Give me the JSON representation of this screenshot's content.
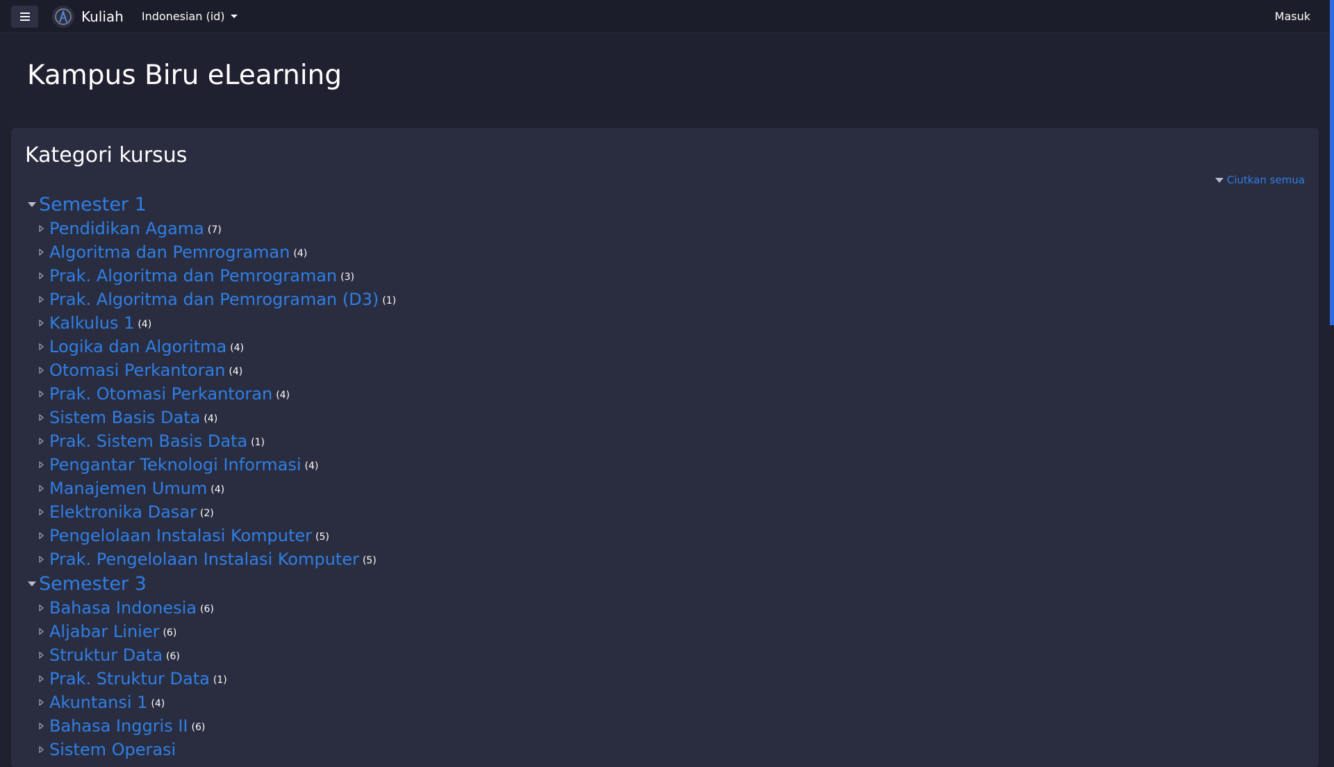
{
  "navbar": {
    "menu_icon": "hamburger-icon",
    "logo_icon": "kuliah-logo-icon",
    "site_name": "Kuliah",
    "language": "Indonesian (id)",
    "login": "Masuk"
  },
  "page": {
    "title": "Kampus Biru eLearning"
  },
  "card": {
    "title": "Kategori kursus",
    "collapse_all": "Ciutkan semua"
  },
  "categories": [
    {
      "name": "Semester 1",
      "items": [
        {
          "name": "Pendidikan Agama",
          "count": "(7)"
        },
        {
          "name": "Algoritma dan Pemrograman",
          "count": "(4)"
        },
        {
          "name": "Prak. Algoritma dan Pemrograman",
          "count": "(3)"
        },
        {
          "name": "Prak. Algoritma dan Pemrograman (D3)",
          "count": "(1)"
        },
        {
          "name": "Kalkulus 1",
          "count": "(4)"
        },
        {
          "name": "Logika dan Algoritma",
          "count": "(4)"
        },
        {
          "name": "Otomasi Perkantoran",
          "count": "(4)"
        },
        {
          "name": "Prak. Otomasi Perkantoran",
          "count": "(4)"
        },
        {
          "name": "Sistem Basis Data",
          "count": "(4)"
        },
        {
          "name": "Prak. Sistem Basis Data",
          "count": "(1)"
        },
        {
          "name": "Pengantar Teknologi Informasi",
          "count": "(4)"
        },
        {
          "name": "Manajemen Umum",
          "count": "(4)"
        },
        {
          "name": "Elektronika Dasar",
          "count": "(2)"
        },
        {
          "name": "Pengelolaan Instalasi Komputer",
          "count": "(5)"
        },
        {
          "name": "Prak. Pengelolaan Instalasi Komputer",
          "count": "(5)"
        }
      ]
    },
    {
      "name": "Semester 3",
      "items": [
        {
          "name": "Bahasa Indonesia",
          "count": "(6)"
        },
        {
          "name": "Aljabar Linier",
          "count": "(6)"
        },
        {
          "name": "Struktur Data",
          "count": "(6)"
        },
        {
          "name": "Prak. Struktur Data",
          "count": "(1)"
        },
        {
          "name": "Akuntansi 1",
          "count": "(4)"
        },
        {
          "name": "Bahasa Inggris II",
          "count": "(6)"
        },
        {
          "name": "Sistem Operasi",
          "count": ""
        }
      ]
    }
  ],
  "colors": {
    "background": "#1f2130",
    "navbar": "#1b1d2a",
    "card": "#2a2d3f",
    "link": "#2f7fe6",
    "scrollbar": "#2f6be0"
  }
}
